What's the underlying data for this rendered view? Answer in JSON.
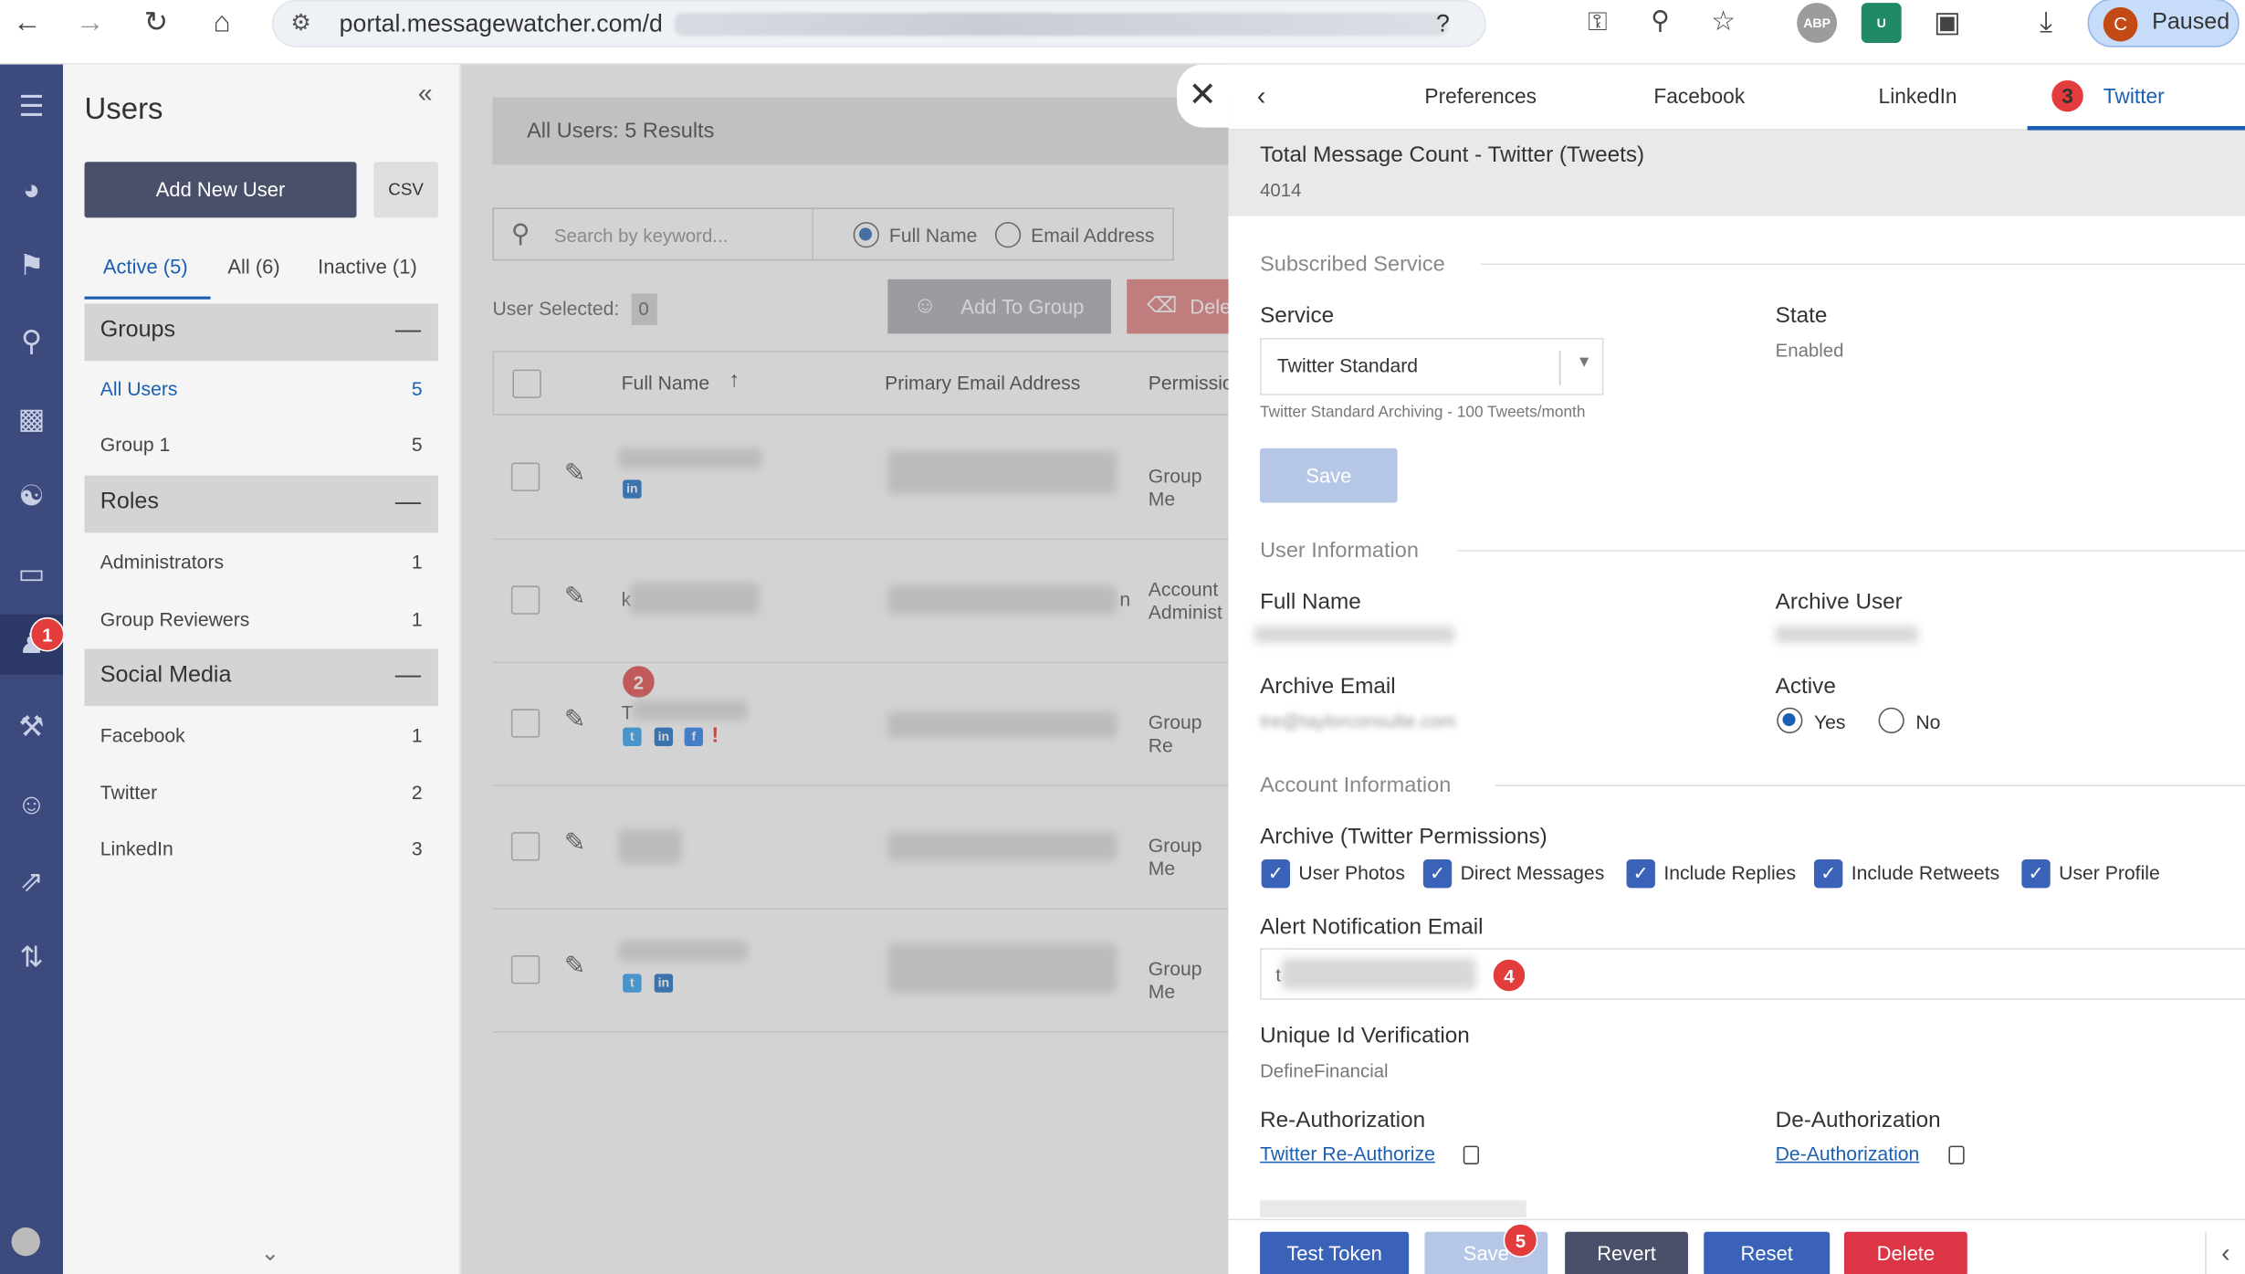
{
  "browser": {
    "url": "portal.messagewatcher.com/d",
    "url_tail": "?",
    "extensions": [
      "ABP",
      "U"
    ],
    "profile_initial": "C",
    "profile_status": "Paused"
  },
  "nav": {
    "icons": [
      "menu-icon",
      "dashboard-icon",
      "flag-icon",
      "search-icon",
      "chart-icon",
      "globe-icon",
      "folder-icon",
      "user-icon",
      "tools-icon",
      "group-icon",
      "share-icon",
      "shuffle-icon"
    ],
    "active": "user-icon",
    "badge": "1"
  },
  "users_panel": {
    "title": "Users",
    "add_button": "Add New User",
    "csv_label": "CSV",
    "tabs": [
      {
        "label": "Active (5)",
        "selected": true
      },
      {
        "label": "All (6)",
        "selected": false
      },
      {
        "label": "Inactive (1)",
        "selected": false
      }
    ],
    "sections": [
      {
        "title": "Groups",
        "items": [
          {
            "label": "All Users",
            "count": "5"
          },
          {
            "label": "Group 1",
            "count": "5"
          }
        ]
      },
      {
        "title": "Roles",
        "items": [
          {
            "label": "Administrators",
            "count": "1"
          },
          {
            "label": "Group Reviewers",
            "count": "1"
          }
        ]
      },
      {
        "title": "Social Media",
        "items": [
          {
            "label": "Facebook",
            "count": "1"
          },
          {
            "label": "Twitter",
            "count": "2"
          },
          {
            "label": "LinkedIn",
            "count": "3"
          }
        ]
      }
    ],
    "collapse_symbol": "—"
  },
  "main": {
    "results": "All Users: 5 Results",
    "search_placeholder": "Search by keyword...",
    "radio_full_name": "Full Name",
    "radio_email": "Email Address",
    "user_selected_label": "User Selected:",
    "user_selected_count": "0",
    "add_to_group": "Add To Group",
    "delete": "Dele",
    "columns": [
      "Full Name",
      "Primary Email Address",
      "Permissio"
    ],
    "rows": [
      {
        "name_prefix": "",
        "permission": "Group Me",
        "socials": [
          "linkedin"
        ]
      },
      {
        "name_prefix": "k",
        "permission": "Account Administ",
        "socials": []
      },
      {
        "name_prefix": "T",
        "permission": "Group Re",
        "socials": [
          "twitter",
          "linkedin",
          "facebook",
          "alert"
        ]
      },
      {
        "name_prefix": "",
        "permission": "Group Me",
        "socials": []
      },
      {
        "name_prefix": "",
        "permission": "Group Me",
        "socials": [
          "twitter",
          "linkedin"
        ]
      }
    ],
    "email_suffix": "n",
    "badge2": "2"
  },
  "detail": {
    "tabs": [
      "Preferences",
      "Facebook",
      "LinkedIn",
      "Twitter"
    ],
    "active_tab": "Twitter",
    "badge3": "3",
    "count_title": "Total Message Count - Twitter (Tweets)",
    "count_value": "4014",
    "subscribed_service": "Subscribed Service",
    "service_label": "Service",
    "service_value": "Twitter Standard",
    "service_note": "Twitter Standard Archiving - 100 Tweets/month",
    "state_label": "State",
    "state_value": "Enabled",
    "save_label": "Save",
    "user_information": "User Information",
    "full_name_label": "Full Name",
    "archive_user_label": "Archive User",
    "archive_email_label": "Archive Email",
    "archive_email_value": "tre@taylorconsulte.com",
    "active_label": "Active",
    "active_yes": "Yes",
    "active_no": "No",
    "account_information": "Account Information",
    "archive_perms_label": "Archive (Twitter Permissions)",
    "permissions": [
      "User Photos",
      "Direct Messages",
      "Include Replies",
      "Include Retweets",
      "User Profile"
    ],
    "alert_email_label": "Alert Notification Email",
    "alert_email_prefix": "t",
    "badge4": "4",
    "unique_id_label": "Unique Id Verification",
    "unique_id_value": "DefineFinancial",
    "reauth_label": "Re-Authorization",
    "reauth_link": "Twitter Re-Authorize",
    "deauth_label": "De-Authorization",
    "deauth_link": "De-Authorization",
    "buttons": {
      "test_token": "Test Token",
      "save": "Save",
      "revert": "Revert",
      "reset": "Reset",
      "delete": "Delete"
    },
    "badge5": "5"
  },
  "colors": {
    "nav": "#3c4a7e",
    "accent": "#1a5fb4",
    "badge": "#e23c3c",
    "delete": "#dc3545"
  }
}
